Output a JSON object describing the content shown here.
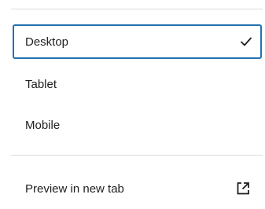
{
  "menu": {
    "items": [
      {
        "label": "Desktop",
        "selected": true,
        "icon": "check-icon"
      },
      {
        "label": "Tablet",
        "selected": false
      },
      {
        "label": "Mobile",
        "selected": false
      }
    ],
    "preview": {
      "label": "Preview in new tab",
      "icon": "external-link-icon"
    }
  },
  "colors": {
    "accent": "#2271b1",
    "divider": "#dcdcde",
    "text": "#1e1e1e"
  }
}
